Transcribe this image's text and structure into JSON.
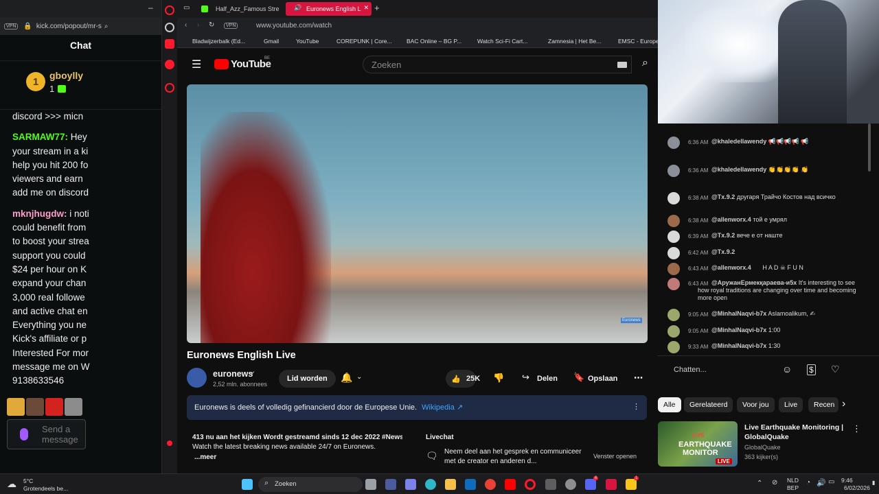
{
  "kick": {
    "url": "kick.com/popout/mr-s",
    "vpn": "VPN",
    "chat_title": "Chat",
    "pinned_user": "gboylly",
    "pinned_badge": "1",
    "pinned_count": "1",
    "messages": [
      {
        "lines": [
          "discord >>> micn"
        ]
      },
      {
        "user": "SARMAW77:",
        "text": " Hey",
        "lines": [
          "your stream in a ki",
          "help you hit 200 fo",
          "viewers and earn",
          "add me on discord"
        ]
      },
      {
        "user": "mknjhugdw:",
        "text": " i noti",
        "lines": [
          "could benefit from",
          "to boost your strea",
          "support you could",
          "$24 per hour on K",
          "expand your chan",
          "3,000 real followe",
          "and active chat en",
          "Everything you ne",
          "Kick's affiliate or p",
          "Interested For mor",
          "message me on W",
          "9138633546"
        ]
      }
    ],
    "send_placeholder": "Send a message"
  },
  "browser": {
    "tabs": [
      {
        "label": "Half_Azz_Famous Stre"
      },
      {
        "label": "Euronews English L"
      }
    ],
    "vpn": "VPN",
    "url": "www.youtube.com/watch",
    "bookmarks": [
      "Bladwijzerbalk (Ed...",
      "Gmail",
      "YouTube",
      "COREPUNK | Core...",
      "BAC Online – BG P...",
      "Watch Sci-Fi Cart...",
      "Zamnesia | Het Be...",
      "EMSC - Europe"
    ]
  },
  "youtube": {
    "logo": "YouTube",
    "region": "BE",
    "search_placeholder": "Zoeken",
    "video_title": "Euronews English Live",
    "channel": "euronews",
    "subscribers": "2,52 mln. abonnees",
    "join": "Lid worden",
    "likes": "25K",
    "share": "Delen",
    "save": "Opslaan",
    "info": "Euronews is deels of volledig gefinancierd door de Europese Unie.",
    "info_link": "Wikipedia ↗",
    "watching": "413 nu aan het kijken  Wordt gestreamd sinds 12 dec 2022  #News",
    "description": "Watch the latest breaking news available 24/7 on Euronews.",
    "more": "...meer",
    "livechat_title": "Livechat",
    "livechat_desc": "Neem deel aan het gesprek en communiceer met de creator en anderen d...",
    "open_window": "Venster openen",
    "video_watermark": "Euronews"
  },
  "livechat": {
    "messages": [
      {
        "time": "6:36 AM",
        "user": "@khaledellawendy",
        "text": "📢📢📢📢 📢"
      },
      {
        "time": "6:36 AM",
        "user": "@khaledellawendy",
        "text": "👏👏👏👏 👏"
      },
      {
        "time": "6:38 AM",
        "user": "@Tx.9.2",
        "text": "другаря Трайчо Костов над всичко"
      },
      {
        "time": "6:38 AM",
        "user": "@allenworx.4",
        "text": "той е умрял"
      },
      {
        "time": "6:39 AM",
        "user": "@Tx.9.2",
        "text": "вече е от наште"
      },
      {
        "time": "6:42 AM",
        "user": "@Tx.9.2",
        "text": ""
      },
      {
        "time": "6:43 AM",
        "user": "@allenworx.4",
        "text": "H A D ☠ F U N"
      },
      {
        "time": "6:43 AM",
        "user": "@АружанЕрмекқараева-и5х",
        "text": "It's interesting to see how royal traditions are changing over time and becoming more open"
      },
      {
        "time": "9:05 AM",
        "user": "@MinhalNaqvi-b7x",
        "text": "Aslamoalikum, ✍"
      },
      {
        "time": "9:05 AM",
        "user": "@MinhalNaqvi-b7x",
        "text": "1:00"
      },
      {
        "time": "9:33 AM",
        "user": "@MinhalNaqvi-b7x",
        "text": "1:30"
      }
    ],
    "input_placeholder": "Chatten..."
  },
  "chips": [
    "Alle",
    "Gerelateerd",
    "Voor jou",
    "Live",
    "Recen"
  ],
  "recommended": {
    "title": "Live Earthquake Monitoring | GlobalQuake",
    "channel": "GlobalQuake",
    "viewers": "363 kijker(s)",
    "thumb_text1": "LIVE",
    "thumb_text2": "EARTHQUAKE",
    "thumb_text3": "MONITOR",
    "live_badge": "LIVE"
  },
  "taskbar": {
    "temp": "5°C",
    "weather": "Grotendeels be...",
    "search": "Zoeken",
    "lang1": "NLD",
    "lang2": "BEP",
    "time": "9:46",
    "date": "6/02/2026",
    "discord_badge": "6",
    "mail_badge": "1"
  }
}
